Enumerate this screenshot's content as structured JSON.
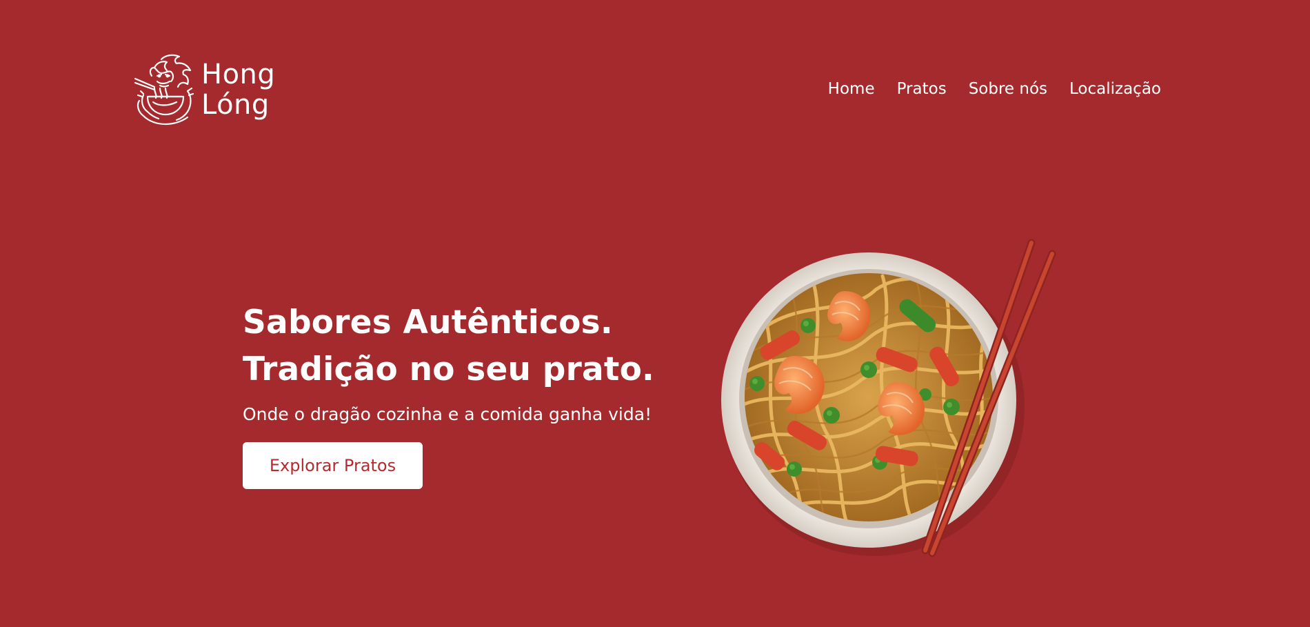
{
  "brand": {
    "line1": "Hong",
    "line2": "Lóng",
    "logo_icon": "dragon-eating-noodles-icon"
  },
  "nav": {
    "items": [
      "Home",
      "Pratos",
      "Sobre nós",
      "Localização"
    ]
  },
  "hero": {
    "title_line1": "Sabores Autênticos.",
    "title_line2": "Tradição no seu prato.",
    "subtitle": "Onde o dragão cozinha e a comida ganha vida!",
    "cta_label": "Explorar Pratos",
    "image": "noodle-bowl-with-shrimp-and-chopsticks"
  },
  "colors": {
    "background": "#a52a2d",
    "button_bg": "#ffffff",
    "button_text": "#b62a2e",
    "text": "#ffffff"
  }
}
